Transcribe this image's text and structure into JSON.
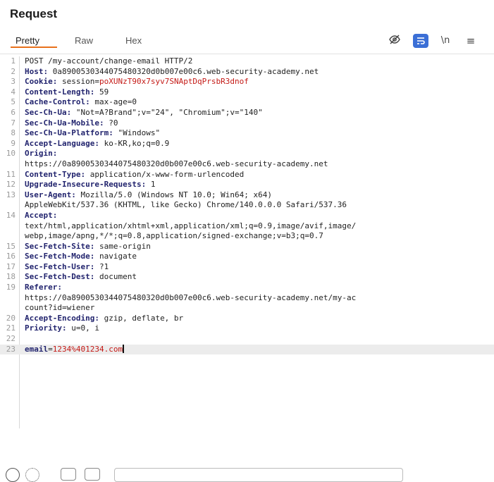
{
  "panel": {
    "title": "Request"
  },
  "tabs": [
    {
      "label": "Pretty"
    },
    {
      "label": "Raw"
    },
    {
      "label": "Hex"
    }
  ],
  "toolbar": {
    "newline_label": "\\n",
    "menu_label": "≡"
  },
  "request_lines": [
    {
      "n": "1",
      "key": "",
      "sep": "",
      "value": "POST /my-account/change-email HTTP/2",
      "value_red": ""
    },
    {
      "n": "2",
      "key": "Host",
      "sep": ": ",
      "value": "0a8900530344075480320d0b007e00c6.web-security-academy.net",
      "value_red": ""
    },
    {
      "n": "3",
      "key": "Cookie",
      "sep": ": ",
      "value": "session=",
      "value_red": "poXUNzT90x7syv7SNAptDqPrsbR3dnof"
    },
    {
      "n": "4",
      "key": "Content-Length",
      "sep": ": ",
      "value": "59",
      "value_red": ""
    },
    {
      "n": "5",
      "key": "Cache-Control",
      "sep": ": ",
      "value": "max-age=0",
      "value_red": ""
    },
    {
      "n": "6",
      "key": "Sec-Ch-Ua",
      "sep": ": ",
      "value": "\"Not=A?Brand\";v=\"24\", \"Chromium\";v=\"140\"",
      "value_red": ""
    },
    {
      "n": "7",
      "key": "Sec-Ch-Ua-Mobile",
      "sep": ": ",
      "value": "?0",
      "value_red": ""
    },
    {
      "n": "8",
      "key": "Sec-Ch-Ua-Platform",
      "sep": ": ",
      "value": "\"Windows\"",
      "value_red": ""
    },
    {
      "n": "9",
      "key": "Accept-Language",
      "sep": ": ",
      "value": "ko-KR,ko;q=0.9",
      "value_red": ""
    },
    {
      "n": "10",
      "key": "Origin",
      "sep": ":",
      "value": "",
      "value_red": ""
    },
    {
      "n": "",
      "key": "",
      "sep": "",
      "value": "https://0a8900530344075480320d0b007e00c6.web-security-academy.net",
      "value_red": ""
    },
    {
      "n": "11",
      "key": "Content-Type",
      "sep": ": ",
      "value": "application/x-www-form-urlencoded",
      "value_red": ""
    },
    {
      "n": "12",
      "key": "Upgrade-Insecure-Requests",
      "sep": ": ",
      "value": "1",
      "value_red": ""
    },
    {
      "n": "13",
      "key": "User-Agent",
      "sep": ": ",
      "value": "Mozilla/5.0 (Windows NT 10.0; Win64; x64)",
      "value_red": ""
    },
    {
      "n": "",
      "key": "",
      "sep": "",
      "value": "AppleWebKit/537.36 (KHTML, like Gecko) Chrome/140.0.0.0 Safari/537.36",
      "value_red": ""
    },
    {
      "n": "14",
      "key": "Accept",
      "sep": ":",
      "value": "",
      "value_red": ""
    },
    {
      "n": "",
      "key": "",
      "sep": "",
      "value": "text/html,application/xhtml+xml,application/xml;q=0.9,image/avif,image/",
      "value_red": ""
    },
    {
      "n": "",
      "key": "",
      "sep": "",
      "value": "webp,image/apng,*/*;q=0.8,application/signed-exchange;v=b3;q=0.7",
      "value_red": ""
    },
    {
      "n": "15",
      "key": "Sec-Fetch-Site",
      "sep": ": ",
      "value": "same-origin",
      "value_red": ""
    },
    {
      "n": "16",
      "key": "Sec-Fetch-Mode",
      "sep": ": ",
      "value": "navigate",
      "value_red": ""
    },
    {
      "n": "17",
      "key": "Sec-Fetch-User",
      "sep": ": ",
      "value": "?1",
      "value_red": ""
    },
    {
      "n": "18",
      "key": "Sec-Fetch-Dest",
      "sep": ": ",
      "value": "document",
      "value_red": ""
    },
    {
      "n": "19",
      "key": "Referer",
      "sep": ":",
      "value": "",
      "value_red": ""
    },
    {
      "n": "",
      "key": "",
      "sep": "",
      "value": "https://0a8900530344075480320d0b007e00c6.web-security-academy.net/my-ac",
      "value_red": ""
    },
    {
      "n": "",
      "key": "",
      "sep": "",
      "value": "count?id=wiener",
      "value_red": ""
    },
    {
      "n": "20",
      "key": "Accept-Encoding",
      "sep": ": ",
      "value": "gzip, deflate, br",
      "value_red": ""
    },
    {
      "n": "21",
      "key": "Priority",
      "sep": ": ",
      "value": "u=0, i",
      "value_red": ""
    },
    {
      "n": "22",
      "key": "",
      "sep": "",
      "value": "",
      "value_red": ""
    },
    {
      "n": "23",
      "key": "",
      "sep": "",
      "value": "",
      "value_red": "",
      "body_key": "email",
      "body_eq": "=",
      "body_value": "1234%401234.com",
      "current": true
    }
  ],
  "icons": {
    "toolbar": [
      "eye-off-icon",
      "wrap-text-icon",
      "newline-icon",
      "menu-icon"
    ],
    "bottom": [
      "help-icon",
      "settings-icon",
      "prev-icon",
      "next-icon"
    ]
  },
  "colors": {
    "accent": "#e8711c",
    "header_key": "#22246e",
    "highlight": "#c41a16",
    "wrap_button": "#3b6fd6"
  }
}
